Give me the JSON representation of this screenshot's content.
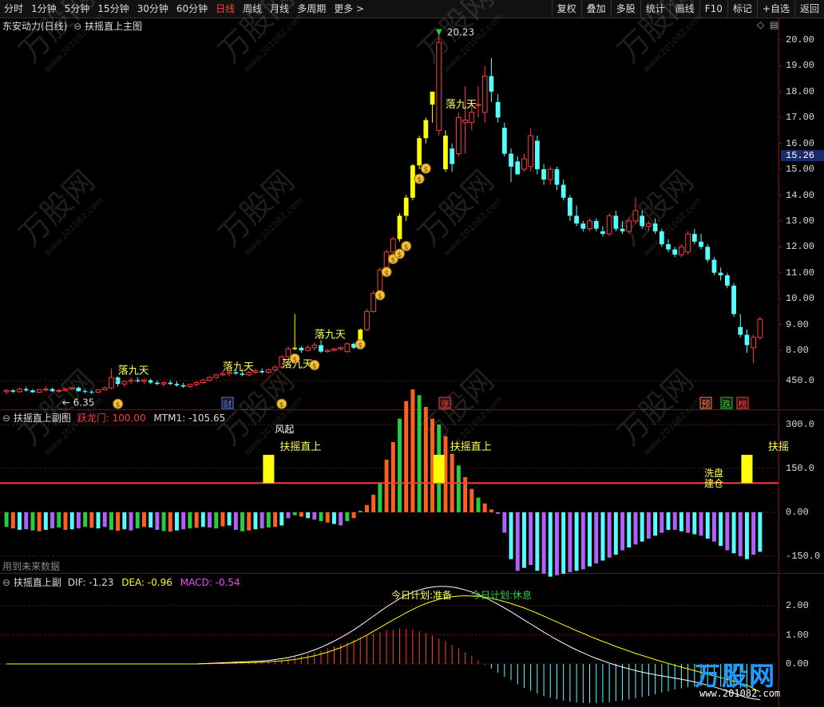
{
  "toolbar": {
    "periods": [
      "分时",
      "1分钟",
      "5分钟",
      "15分钟",
      "30分钟",
      "60分钟",
      "日线",
      "周线",
      "月线",
      "多周期",
      "更多 >"
    ],
    "active_period": "日线",
    "buttons": [
      "复权",
      "叠加",
      "多股",
      "统计",
      "画线",
      "F10",
      "标记",
      "+自选",
      "返回"
    ]
  },
  "main_panel": {
    "stock_name": "东安动力(日线)",
    "indicator_name": "扶摇直上主图",
    "price_axis": [
      "20.00",
      "19.00",
      "18.00",
      "17.00",
      "16.00",
      "15.00",
      "14.00",
      "13.00",
      "12.00",
      "11.00",
      "10.00",
      "9.00",
      "8.00"
    ],
    "current_price": "15.26",
    "high_label": "20.23",
    "low_label": "6.35",
    "annotation_texts": [
      "落九天",
      "落九天",
      "落九天",
      "落九天",
      "落九天"
    ],
    "event_markers": [
      "财",
      "涨",
      "预",
      "跌",
      "榜"
    ]
  },
  "sub_panel_1": {
    "title": "扶摇直上副图",
    "label_1": "跃龙门: 100.00",
    "label_2": "MTM1: -105.65",
    "axis": [
      "450.0",
      "300.0",
      "150.0",
      "0.00",
      "-150.0"
    ],
    "annotations": [
      "风起",
      "扶摇直上",
      "扶摇直上",
      "洗盘",
      "建仓",
      "扶摇"
    ],
    "footer_note": "用到未来数据"
  },
  "sub_panel_2": {
    "title": "扶摇直上副",
    "dif": "DIF: -1.23",
    "dea": "DEA: -0.96",
    "macd": "MACD: -0.54",
    "axis": [
      "2.00",
      "1.00",
      "0.00"
    ],
    "annotation_1": "今日计划:准备",
    "annotation_2": "今日计划:休息"
  },
  "watermark": {
    "brand": "万股网",
    "url": "www.201082.com"
  },
  "colors": {
    "up": "#ff3c3c",
    "down": "#54ffff",
    "signal": "#ffff00",
    "background": "#000000",
    "grid": "#7a1010"
  },
  "chart_data": [
    {
      "type": "candlestick",
      "title": "扶摇直上主图",
      "y_range": [
        6.0,
        20.5
      ],
      "candles": [
        [
          6.4,
          6.5,
          6.3,
          6.45
        ],
        [
          6.45,
          6.5,
          6.35,
          6.4
        ],
        [
          6.4,
          6.55,
          6.35,
          6.5
        ],
        [
          6.5,
          6.6,
          6.4,
          6.45
        ],
        [
          6.45,
          6.5,
          6.35,
          6.38
        ],
        [
          6.38,
          6.5,
          6.35,
          6.48
        ],
        [
          6.48,
          6.6,
          6.4,
          6.5
        ],
        [
          6.5,
          6.55,
          6.4,
          6.42
        ],
        [
          6.42,
          6.5,
          6.35,
          6.45
        ],
        [
          6.45,
          6.55,
          6.4,
          6.5
        ],
        [
          6.5,
          6.6,
          6.45,
          6.55
        ],
        [
          6.55,
          6.6,
          6.4,
          6.42
        ],
        [
          6.42,
          6.5,
          6.35,
          6.4
        ],
        [
          6.4,
          6.45,
          6.3,
          6.38
        ],
        [
          6.38,
          6.5,
          6.35,
          6.47
        ],
        [
          6.47,
          6.6,
          6.45,
          6.55
        ],
        [
          6.55,
          7.3,
          6.5,
          6.95
        ],
        [
          6.95,
          7.0,
          6.6,
          6.7
        ],
        [
          6.7,
          6.85,
          6.6,
          6.8
        ],
        [
          6.8,
          6.95,
          6.7,
          6.85
        ],
        [
          6.85,
          6.95,
          6.75,
          6.8
        ],
        [
          6.8,
          6.9,
          6.7,
          6.85
        ],
        [
          6.85,
          6.9,
          6.7,
          6.75
        ],
        [
          6.75,
          6.85,
          6.65,
          6.7
        ],
        [
          6.7,
          6.8,
          6.6,
          6.75
        ],
        [
          6.75,
          6.85,
          6.65,
          6.7
        ],
        [
          6.7,
          6.8,
          6.6,
          6.65
        ],
        [
          6.65,
          6.75,
          6.55,
          6.6
        ],
        [
          6.6,
          6.7,
          6.55,
          6.68
        ],
        [
          6.68,
          6.8,
          6.6,
          6.75
        ],
        [
          6.75,
          6.9,
          6.7,
          6.85
        ],
        [
          6.85,
          7.0,
          6.8,
          6.95
        ],
        [
          6.95,
          7.1,
          6.9,
          7.05
        ],
        [
          7.05,
          7.2,
          7.0,
          7.1
        ],
        [
          7.1,
          7.25,
          7.0,
          7.15
        ],
        [
          7.15,
          7.25,
          7.05,
          7.1
        ],
        [
          7.1,
          7.2,
          7.0,
          7.05
        ],
        [
          7.05,
          7.2,
          7.0,
          7.15
        ],
        [
          7.15,
          7.3,
          7.1,
          7.2
        ],
        [
          7.2,
          7.3,
          7.1,
          7.15
        ],
        [
          7.15,
          7.3,
          7.1,
          7.25
        ],
        [
          7.25,
          7.4,
          7.2,
          7.35
        ],
        [
          7.35,
          7.8,
          7.3,
          7.75
        ],
        [
          7.75,
          8.15,
          7.7,
          8.05
        ],
        [
          8.05,
          9.4,
          8.0,
          8.1
        ],
        [
          8.1,
          8.15,
          7.9,
          8.0
        ],
        [
          8.0,
          8.2,
          7.95,
          8.1
        ],
        [
          8.1,
          8.3,
          8.0,
          8.2
        ],
        [
          8.2,
          8.4,
          7.9,
          7.95
        ],
        [
          7.95,
          8.05,
          7.9,
          8.0
        ],
        [
          8.0,
          8.1,
          7.95,
          8.05
        ],
        [
          8.05,
          8.15,
          8.0,
          8.1
        ],
        [
          7.95,
          8.3,
          7.9,
          8.25
        ],
        [
          8.25,
          8.3,
          8.05,
          8.1
        ],
        [
          8.1,
          8.85,
          8.05,
          8.8
        ],
        [
          8.8,
          9.6,
          8.75,
          9.5
        ],
        [
          9.5,
          10.3,
          9.45,
          10.2
        ],
        [
          10.2,
          11.2,
          10.1,
          11.1
        ],
        [
          11.1,
          11.9,
          11.0,
          11.8
        ],
        [
          11.8,
          12.4,
          11.6,
          12.3
        ],
        [
          12.3,
          13.3,
          12.2,
          13.2
        ],
        [
          13.2,
          14.0,
          13.0,
          13.9
        ],
        [
          13.9,
          15.2,
          13.8,
          15.15
        ],
        [
          15.15,
          16.3,
          15.0,
          16.2
        ],
        [
          16.2,
          17.0,
          16.0,
          16.9
        ],
        [
          17.5,
          18.0,
          16.8,
          18.0
        ],
        [
          16.5,
          20.23,
          16.3,
          19.9
        ],
        [
          15.0,
          16.5,
          14.9,
          16.3
        ],
        [
          15.8,
          16.0,
          14.9,
          15.2
        ],
        [
          15.6,
          17.2,
          15.5,
          17.0
        ],
        [
          16.8,
          18.2,
          15.6,
          16.9
        ],
        [
          16.8,
          17.6,
          16.5,
          17.2
        ],
        [
          17.5,
          18.2,
          17.0,
          17.5
        ],
        [
          17.2,
          19.0,
          16.8,
          18.6
        ],
        [
          18.6,
          19.3,
          17.6,
          18.0
        ],
        [
          17.6,
          17.9,
          16.8,
          17.0
        ],
        [
          16.6,
          16.8,
          15.5,
          15.6
        ],
        [
          15.6,
          15.8,
          14.5,
          15.1
        ],
        [
          15.3,
          15.5,
          14.8,
          14.8
        ],
        [
          15.0,
          15.6,
          14.9,
          15.4
        ],
        [
          15.1,
          16.6,
          14.9,
          16.3
        ],
        [
          16.1,
          16.3,
          14.8,
          15.0
        ],
        [
          15.0,
          15.2,
          14.4,
          14.6
        ],
        [
          14.6,
          15.1,
          14.4,
          15.0
        ],
        [
          15.0,
          15.1,
          14.2,
          14.4
        ],
        [
          14.4,
          14.6,
          13.8,
          13.9
        ],
        [
          13.9,
          14.0,
          13.0,
          13.2
        ],
        [
          13.2,
          13.6,
          12.8,
          12.9
        ],
        [
          12.9,
          13.0,
          12.6,
          12.7
        ],
        [
          12.7,
          13.1,
          12.6,
          13.0
        ],
        [
          13.0,
          13.1,
          12.6,
          12.7
        ],
        [
          12.6,
          12.8,
          12.4,
          12.5
        ],
        [
          12.5,
          13.3,
          12.4,
          13.2
        ],
        [
          13.2,
          13.4,
          12.6,
          12.7
        ],
        [
          12.7,
          13.0,
          12.5,
          12.6
        ],
        [
          12.6,
          13.1,
          12.5,
          13.0
        ],
        [
          13.0,
          13.9,
          12.9,
          13.4
        ],
        [
          13.2,
          13.4,
          12.7,
          12.8
        ],
        [
          12.8,
          13.0,
          12.6,
          12.9
        ],
        [
          12.9,
          13.1,
          12.5,
          12.6
        ],
        [
          12.6,
          12.7,
          12.0,
          12.1
        ],
        [
          12.1,
          12.3,
          11.8,
          11.9
        ],
        [
          11.9,
          12.0,
          11.6,
          11.7
        ],
        [
          11.7,
          12.1,
          11.6,
          12.0
        ],
        [
          11.8,
          12.6,
          11.7,
          12.5
        ],
        [
          12.5,
          12.7,
          12.1,
          12.2
        ],
        [
          12.2,
          12.5,
          11.9,
          12.0
        ],
        [
          12.0,
          12.1,
          11.4,
          11.5
        ],
        [
          11.5,
          11.6,
          10.9,
          11.0
        ],
        [
          11.0,
          11.2,
          10.7,
          10.9
        ],
        [
          10.9,
          11.0,
          10.4,
          10.5
        ],
        [
          10.5,
          10.6,
          9.3,
          9.4
        ],
        [
          8.9,
          9.4,
          8.5,
          8.6
        ],
        [
          8.6,
          8.8,
          7.9,
          8.2
        ],
        [
          8.1,
          8.6,
          7.5,
          8.5
        ],
        [
          8.5,
          9.3,
          8.4,
          9.2
        ]
      ]
    },
    {
      "type": "bar",
      "title": "扶摇直上副图",
      "y_range": [
        -220,
        500
      ],
      "series": [
        {
          "name": "MTM1",
          "values": [
            -50,
            -55,
            -60,
            -58,
            -62,
            -65,
            -60,
            -55,
            -52,
            -60,
            -58,
            -55,
            -50,
            -53,
            -55,
            -50,
            -60,
            -63,
            -58,
            -62,
            -55,
            -50,
            -52,
            -60,
            -64,
            -66,
            -62,
            -58,
            -55,
            -53,
            -50,
            -52,
            -55,
            -48,
            -45,
            -60,
            -65,
            -62,
            -58,
            -55,
            -52,
            -50,
            -45,
            -20,
            -10,
            -15,
            -20,
            -25,
            -30,
            -35,
            -40,
            -45,
            -30,
            -20,
            5,
            25,
            60,
            100,
            180,
            240,
            320,
            380,
            420,
            400,
            360,
            320,
            300,
            260,
            200,
            160,
            120,
            80,
            50,
            30,
            10,
            -5,
            -70,
            -160,
            -200,
            -190,
            -180,
            -200,
            -210,
            -220,
            -215,
            -210,
            -205,
            -200,
            -195,
            -185,
            -175,
            -165,
            -155,
            -145,
            -130,
            -120,
            -110,
            -100,
            -90,
            -80,
            -70,
            -60,
            -60,
            -65,
            -70,
            -75,
            -80,
            -90,
            -100,
            -115,
            -130,
            -140,
            -150,
            -160,
            -145,
            -135
          ]
        }
      ]
    },
    {
      "type": "line",
      "title": "扶摇直上副",
      "y_range": [
        -1.4,
        3.0
      ],
      "series": [
        {
          "name": "DIF",
          "values": [
            0.0,
            0.0,
            0.0,
            0.0,
            0.0,
            0.0,
            0.0,
            0.0,
            0.0,
            0.0,
            0.0,
            0.0,
            0.0,
            0.0,
            0.0,
            0.0,
            0.0,
            0.0,
            0.0,
            0.0,
            0.0,
            0.0,
            0.0,
            0.0,
            0.0,
            0.0,
            0.0,
            0.0,
            0.0,
            0.0,
            0.01,
            0.02,
            0.03,
            0.04,
            0.05,
            0.06,
            0.07,
            0.08,
            0.09,
            0.1,
            0.12,
            0.15,
            0.18,
            0.22,
            0.27,
            0.33,
            0.4,
            0.48,
            0.57,
            0.67,
            0.78,
            0.9,
            1.03,
            1.17,
            1.32,
            1.48,
            1.64,
            1.8,
            1.96,
            2.1,
            2.24,
            2.36,
            2.46,
            2.54,
            2.6,
            2.64,
            2.66,
            2.66,
            2.64,
            2.6,
            2.54,
            2.47,
            2.38,
            2.28,
            2.17,
            2.05,
            1.92,
            1.79,
            1.65,
            1.51,
            1.37,
            1.23,
            1.09,
            0.96,
            0.83,
            0.71,
            0.59,
            0.48,
            0.38,
            0.28,
            0.19,
            0.11,
            0.03,
            -0.04,
            -0.11,
            -0.17,
            -0.23,
            -0.28,
            -0.33,
            -0.37,
            -0.41,
            -0.45,
            -0.49,
            -0.53,
            -0.57,
            -0.62,
            -0.67,
            -0.73,
            -0.79,
            -0.86,
            -0.93,
            -1.0,
            -1.08,
            -1.16,
            -1.2,
            -1.23
          ]
        },
        {
          "name": "DEA",
          "values": [
            0.0,
            0.0,
            0.0,
            0.0,
            0.0,
            0.0,
            0.0,
            0.0,
            0.0,
            0.0,
            0.0,
            0.0,
            0.0,
            0.0,
            0.0,
            0.0,
            0.0,
            0.0,
            0.0,
            0.0,
            0.0,
            0.0,
            0.0,
            0.0,
            0.0,
            0.0,
            0.0,
            0.0,
            0.0,
            0.0,
            0.01,
            0.01,
            0.02,
            0.02,
            0.03,
            0.03,
            0.04,
            0.05,
            0.05,
            0.06,
            0.07,
            0.09,
            0.1,
            0.13,
            0.15,
            0.19,
            0.23,
            0.28,
            0.34,
            0.4,
            0.48,
            0.56,
            0.66,
            0.76,
            0.87,
            0.99,
            1.12,
            1.25,
            1.38,
            1.51,
            1.63,
            1.76,
            1.87,
            1.98,
            2.07,
            2.15,
            2.22,
            2.27,
            2.31,
            2.33,
            2.34,
            2.33,
            2.32,
            2.29,
            2.25,
            2.2,
            2.14,
            2.07,
            2.0,
            1.92,
            1.83,
            1.74,
            1.64,
            1.54,
            1.44,
            1.34,
            1.24,
            1.14,
            1.05,
            0.95,
            0.86,
            0.77,
            0.69,
            0.6,
            0.52,
            0.44,
            0.36,
            0.29,
            0.22,
            0.15,
            0.08,
            0.02,
            -0.05,
            -0.11,
            -0.17,
            -0.23,
            -0.29,
            -0.35,
            -0.41,
            -0.47,
            -0.53,
            -0.59,
            -0.66,
            -0.73,
            -0.85,
            -0.96
          ]
        }
      ]
    }
  ]
}
